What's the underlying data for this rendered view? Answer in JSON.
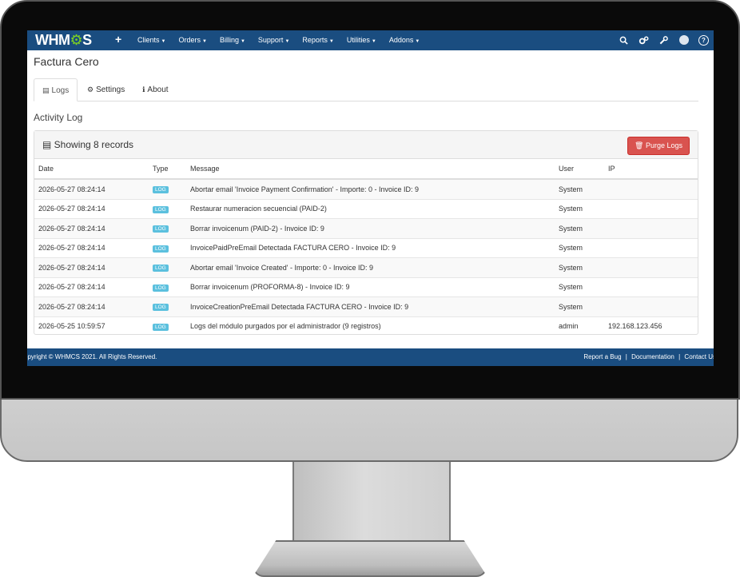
{
  "nav": {
    "logo": "WHMCS",
    "plus": "+",
    "menu": [
      {
        "label": "Clients"
      },
      {
        "label": "Orders"
      },
      {
        "label": "Billing"
      },
      {
        "label": "Support"
      },
      {
        "label": "Reports"
      },
      {
        "label": "Utilities"
      },
      {
        "label": "Addons"
      }
    ],
    "icons": [
      "search-icon",
      "gears-icon",
      "wrench-icon",
      "user-avatar-icon",
      "help-icon"
    ],
    "help_glyph": "?"
  },
  "page": {
    "title": "Factura Cero",
    "tabs": [
      {
        "label": "Logs",
        "icon": "table-icon",
        "active": true
      },
      {
        "label": "Settings",
        "icon": "gear-icon",
        "active": false
      },
      {
        "label": "About",
        "icon": "info-icon",
        "active": false
      }
    ],
    "section_title": "Activity Log"
  },
  "panel": {
    "title": "Showing 8 records",
    "purge_label": "Purge Logs"
  },
  "table": {
    "columns": [
      "Date",
      "Type",
      "Message",
      "User",
      "IP"
    ],
    "rows": [
      [
        "2026-05-27 08:24:14",
        "LOG",
        "Abortar email 'Invoice Payment Confirmation' - Importe: 0 - Invoice ID: 9",
        "System",
        ""
      ],
      [
        "2026-05-27 08:24:14",
        "LOG",
        "Restaurar numeracion secuencial (PAID-2)",
        "System",
        ""
      ],
      [
        "2026-05-27 08:24:14",
        "LOG",
        "Borrar invoicenum (PAID-2) - Invoice ID: 9",
        "System",
        ""
      ],
      [
        "2026-05-27 08:24:14",
        "LOG",
        "InvoicePaidPreEmail Detectada FACTURA CERO - Invoice ID: 9",
        "System",
        ""
      ],
      [
        "2026-05-27 08:24:14",
        "LOG",
        "Abortar email 'Invoice Created' - Importe: 0 - Invoice ID: 9",
        "System",
        ""
      ],
      [
        "2026-05-27 08:24:14",
        "LOG",
        "Borrar invoicenum (PROFORMA-8) - Invoice ID: 9",
        "System",
        ""
      ],
      [
        "2026-05-27 08:24:14",
        "LOG",
        "InvoiceCreationPreEmail Detectada FACTURA CERO - Invoice ID: 9",
        "System",
        ""
      ],
      [
        "2026-05-25 10:59:57",
        "LOG",
        "Logs del módulo purgados por el administrador (9 registros)",
        "admin",
        "192.168.123.456"
      ]
    ]
  },
  "footer": {
    "copyright": "opyright © WHMCS 2021. All Rights Reserved.",
    "links": [
      "Report a Bug",
      "Documentation",
      "Contact Us"
    ],
    "separator": "|"
  },
  "colors": {
    "navbar": "#1a4d80",
    "purge_button": "#d9534f",
    "badge": "#5bc0de",
    "logo_gear": "#7fd321"
  }
}
